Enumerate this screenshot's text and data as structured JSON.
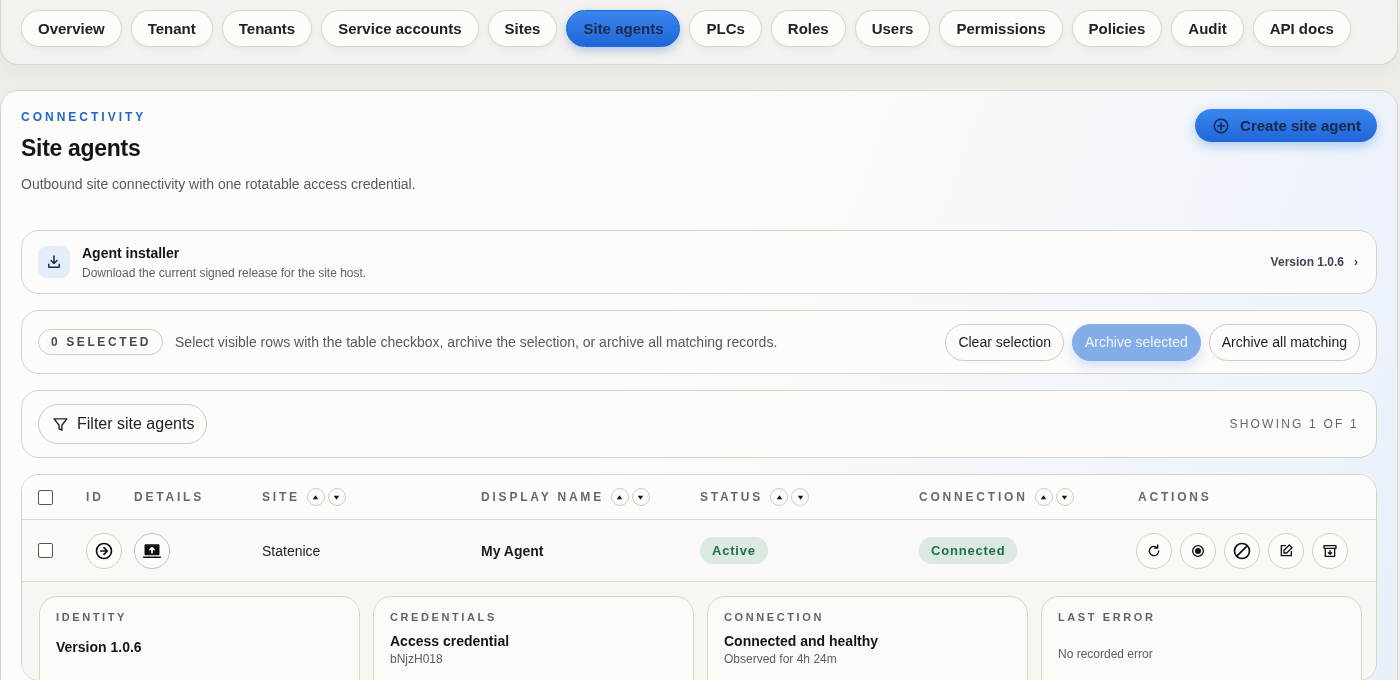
{
  "nav": {
    "tabs": [
      {
        "label": "Overview",
        "selected": false
      },
      {
        "label": "Tenant",
        "selected": false
      },
      {
        "label": "Tenants",
        "selected": false
      },
      {
        "label": "Service accounts",
        "selected": false
      },
      {
        "label": "Sites",
        "selected": false
      },
      {
        "label": "Site agents",
        "selected": true
      },
      {
        "label": "PLCs",
        "selected": false
      },
      {
        "label": "Roles",
        "selected": false
      },
      {
        "label": "Users",
        "selected": false
      },
      {
        "label": "Permissions",
        "selected": false
      },
      {
        "label": "Policies",
        "selected": false
      },
      {
        "label": "Audit",
        "selected": false
      },
      {
        "label": "API docs",
        "selected": false
      }
    ]
  },
  "header": {
    "eyebrow": "CONNECTIVITY",
    "title": "Site agents",
    "subtitle": "Outbound site connectivity with one rotatable access credential.",
    "create_button": "Create site agent"
  },
  "installer": {
    "title": "Agent installer",
    "description": "Download the current signed release for the site host.",
    "version": "Version 1.0.6",
    "chevron": "›"
  },
  "bulk": {
    "count": "0 SELECTED",
    "hint": "Select visible rows with the table checkbox, archive the selection, or archive all matching records.",
    "buttons": [
      {
        "label": "Clear selection",
        "kind": "outline",
        "disabled": false
      },
      {
        "label": "Archive selected",
        "kind": "primary",
        "disabled": true
      },
      {
        "label": "Archive all matching",
        "kind": "outline",
        "disabled": false
      }
    ]
  },
  "filter": {
    "button": "Filter site agents",
    "showing": "SHOWING 1 OF 1"
  },
  "table": {
    "select_all_checked": false,
    "columns": [
      {
        "label": "ID",
        "sortable": false
      },
      {
        "label": "DETAILS",
        "sortable": false
      },
      {
        "label": "SITE",
        "sortable": true
      },
      {
        "label": "DISPLAY NAME",
        "sortable": true
      },
      {
        "label": "STATUS",
        "sortable": true
      },
      {
        "label": "CONNECTION",
        "sortable": true
      },
      {
        "label": "ACTIONS",
        "sortable": false
      }
    ],
    "rows": [
      {
        "checked": false,
        "site": "Statenice",
        "display_name": "My Agent",
        "status": "Active",
        "connection": "Connected"
      }
    ]
  },
  "details": [
    {
      "heading": "IDENTITY",
      "title": "Version 1.0.6"
    },
    {
      "heading": "CREDENTIALS",
      "title": "Access credential",
      "detail": "bNjzH018"
    },
    {
      "heading": "CONNECTION",
      "title": "Connected and healthy",
      "detail": "Observed for 4h 24m"
    },
    {
      "heading": "LAST ERROR",
      "detail": "No recorded error"
    }
  ]
}
